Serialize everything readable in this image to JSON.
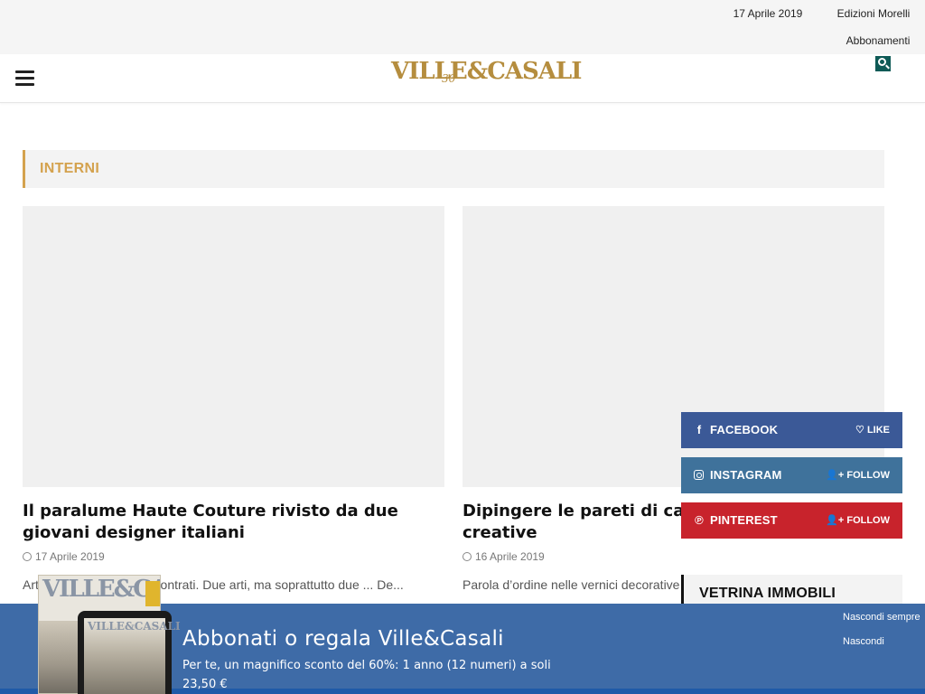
{
  "topbar": {
    "date": "17 Aprile 2019",
    "publisher": "Edizioni Morelli",
    "subscriptions": "Abbonamenti"
  },
  "header": {
    "logo_text": "VILLE&CASALI",
    "logo_badge": "30"
  },
  "section": {
    "title": "INTERNI"
  },
  "articles": [
    {
      "title": "Il paralume Haute Couture rivisto da due giovani designer italiani",
      "date": "17 Aprile 2019",
      "excerpt": "Arte e design si sono incontrati. Due arti, ma soprattutto due ... De..."
    },
    {
      "title": "Dipingere le pareti di casa con texture creative",
      "date": "16 Aprile 2019",
      "excerpt": "Parola d’ordine nelle vernici decorative ... dubbio alle nuance tenui..."
    }
  ],
  "social": [
    {
      "name": "FACEBOOK",
      "action": "LIKE",
      "icon": "facebook-icon",
      "color": "#3b5997"
    },
    {
      "name": "INSTAGRAM",
      "action": "FOLLOW",
      "icon": "instagram-icon",
      "color": "#3f729b"
    },
    {
      "name": "PINTEREST",
      "action": "FOLLOW",
      "icon": "pinterest-icon",
      "color": "#c8232c"
    }
  ],
  "sidebar": {
    "vetrina_title": "VETRINA IMMOBILI"
  },
  "banner": {
    "headline": "Abbonati o regala Ville&Casali",
    "subtext": "Per te, un magnifico sconto del 60%: 1 anno (12 numeri) a soli 23,50 €",
    "hide_always": "Nascondi sempre",
    "hide": "Nascondi",
    "magazine_title": "VILLE&CASALI",
    "tablet_title": "VILLE&CASALI"
  },
  "colors": {
    "accent": "#d4a24e",
    "banner": "#3e6ba7",
    "search": "#0e5a56"
  }
}
